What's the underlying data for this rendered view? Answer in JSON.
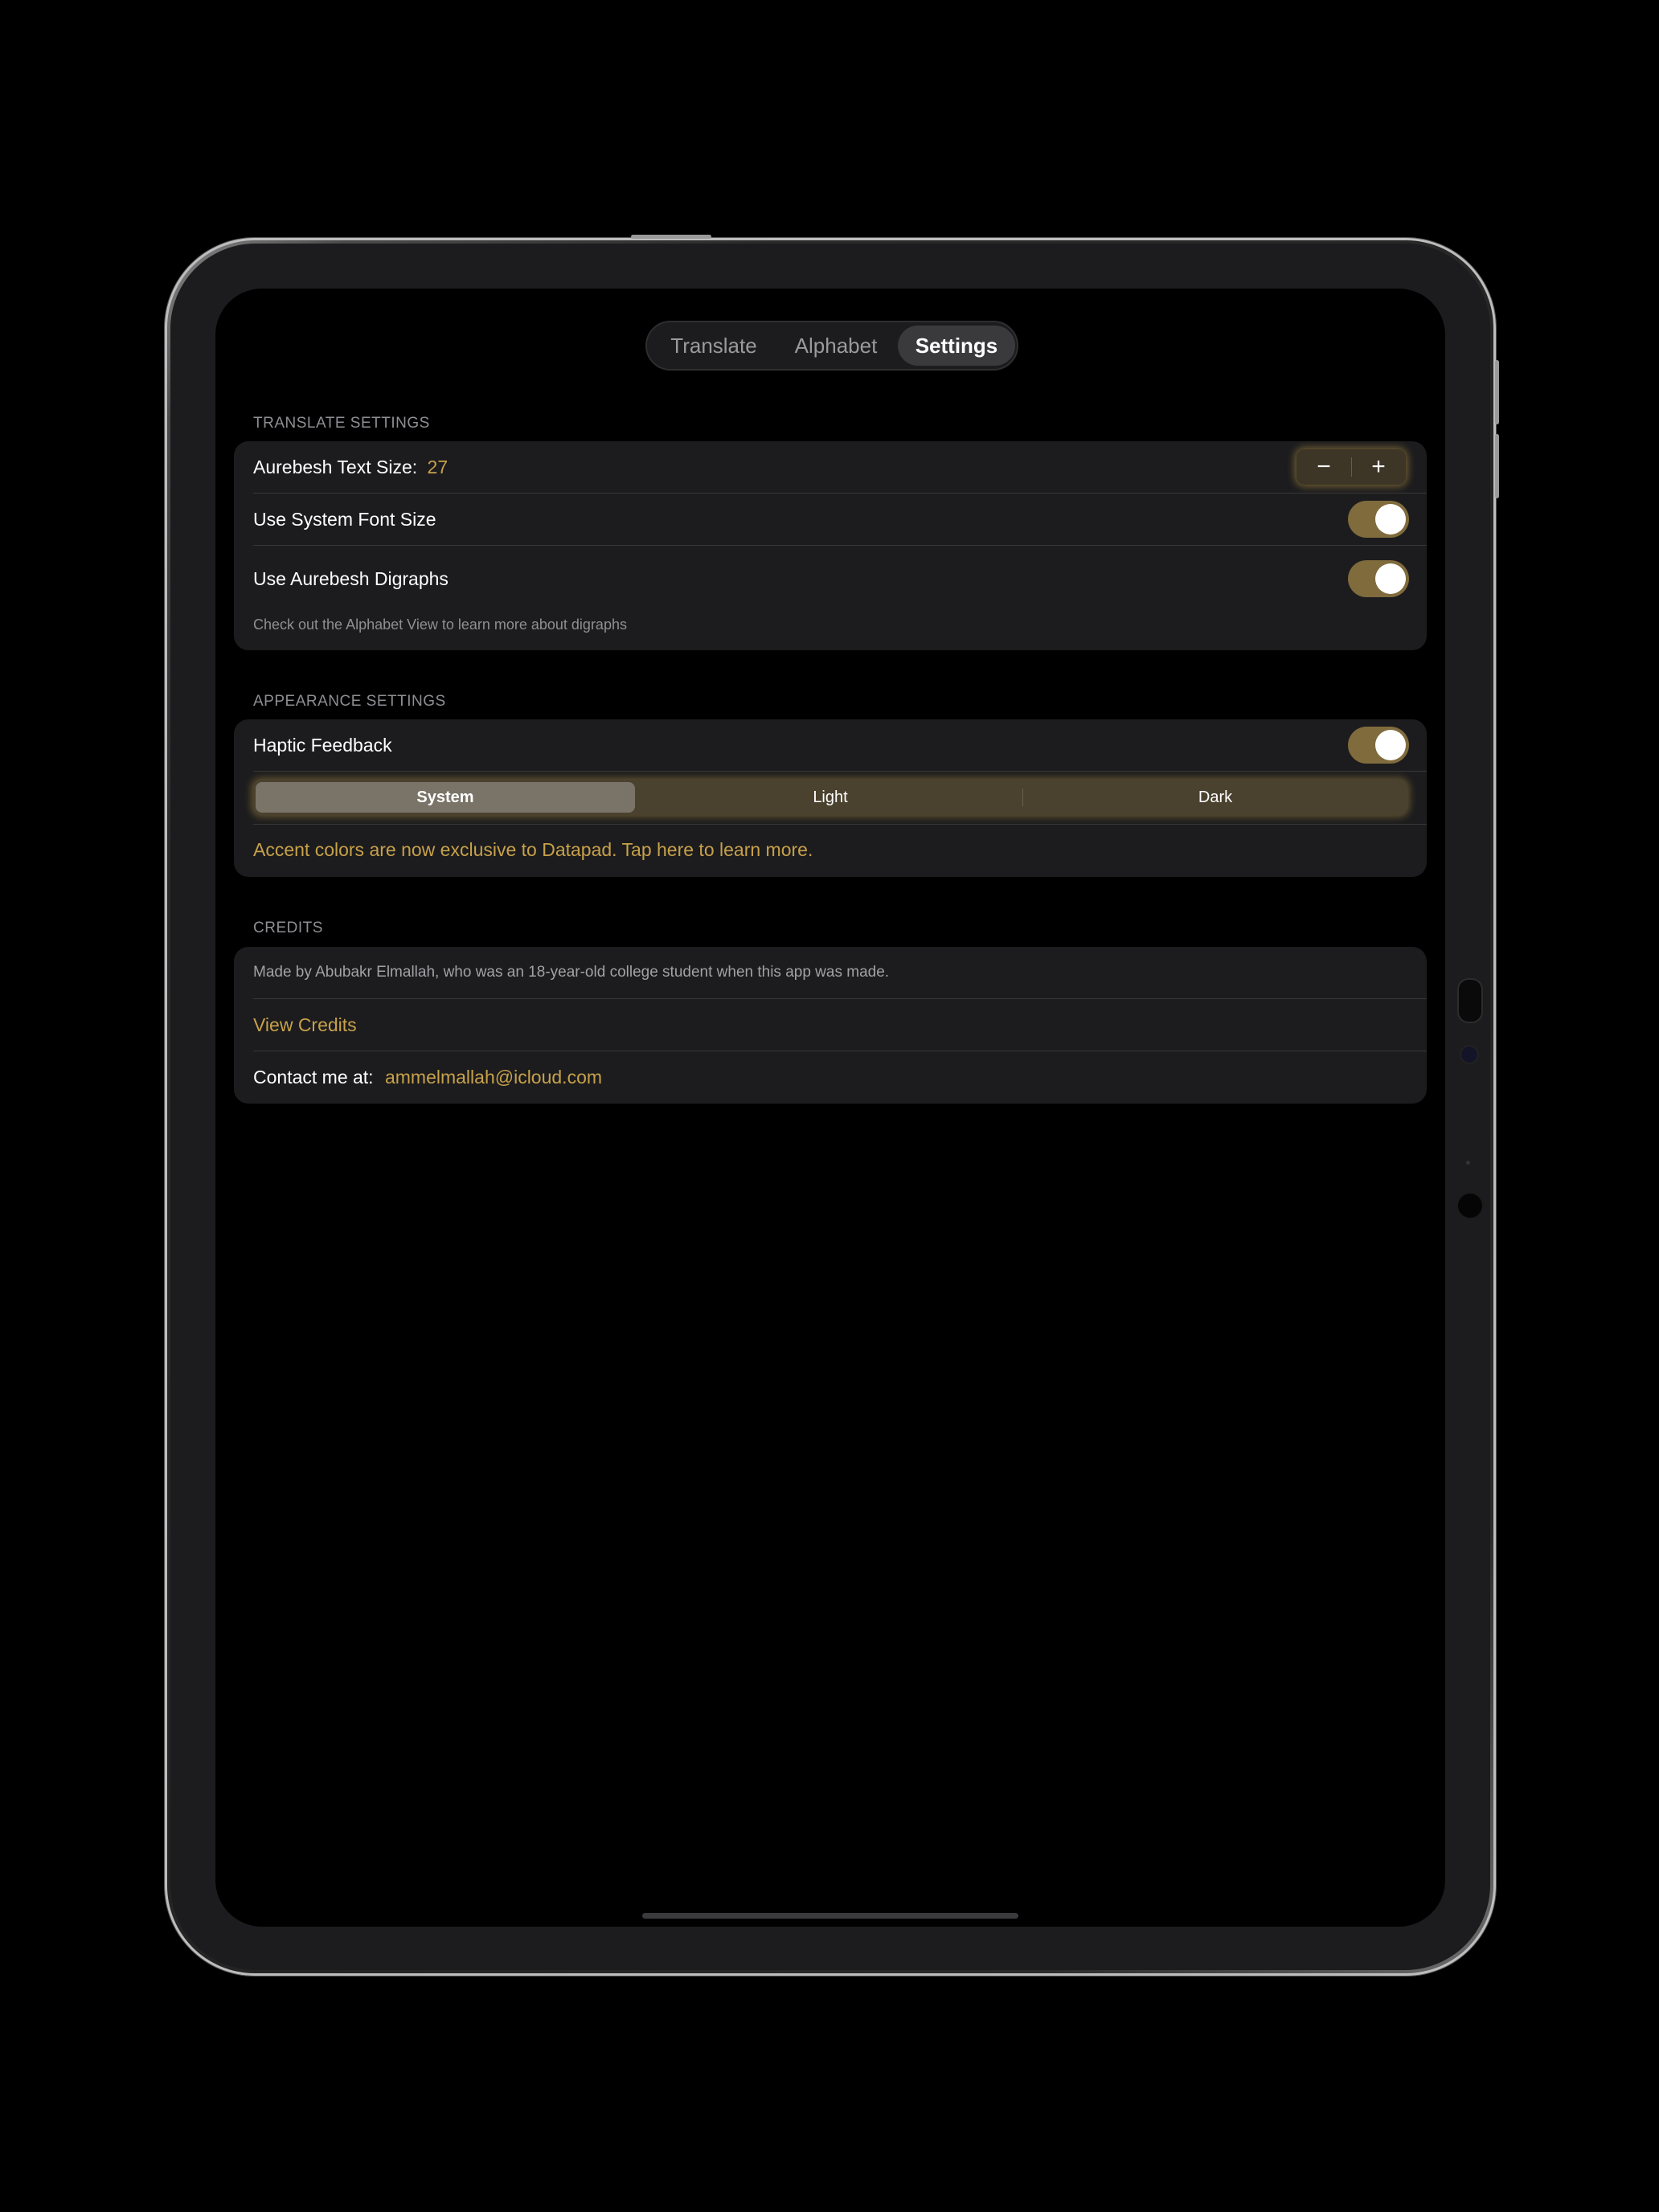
{
  "tabs": [
    {
      "label": "Translate"
    },
    {
      "label": "Alphabet"
    },
    {
      "label": "Settings",
      "selected": true
    }
  ],
  "translate_settings": {
    "header": "TRANSLATE SETTINGS",
    "text_size_label": "Aurebesh Text Size:",
    "text_size_value": "27",
    "stepper_minus": "−",
    "stepper_plus": "+",
    "system_font_label": "Use System Font Size",
    "system_font_on": true,
    "digraphs_label": "Use Aurebesh Digraphs",
    "digraphs_on": true,
    "footnote": "Check out the Alphabet View to learn more about digraphs"
  },
  "appearance_settings": {
    "header": "APPEARANCE SETTINGS",
    "haptic_label": "Haptic Feedback",
    "haptic_on": true,
    "theme_options": [
      "System",
      "Light",
      "Dark"
    ],
    "theme_selected": "System",
    "accent_notice": "Accent colors are now exclusive to Datapad. Tap here to learn more."
  },
  "credits": {
    "header": "CREDITS",
    "made_by": "Made by Abubakr Elmallah, who was an 18-year-old college student when this app was made.",
    "view_credits": "View Credits",
    "contact_label": "Contact me at:",
    "contact_email": "ammelmallah@icloud.com"
  },
  "colors": {
    "accent": "#c7a14a",
    "toggle_on": "#7f6b3c",
    "card_bg": "#1c1c1e",
    "screen_bg": "#000000"
  }
}
